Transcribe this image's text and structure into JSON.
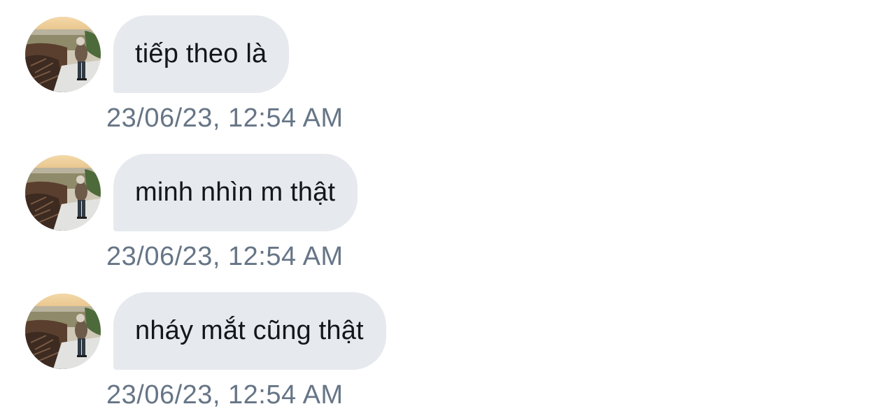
{
  "conversation": {
    "messages": [
      {
        "text": "tiếp theo là",
        "timestamp": "23/06/23, 12:54 AM",
        "avatar_icon": "user-avatar-photo"
      },
      {
        "text": "minh nhìn m thật",
        "timestamp": "23/06/23, 12:54 AM",
        "avatar_icon": "user-avatar-photo"
      },
      {
        "text": "nháy mắt cũng thật",
        "timestamp": "23/06/23, 12:54 AM",
        "avatar_icon": "user-avatar-photo"
      }
    ]
  },
  "colors": {
    "background": "#ffffff",
    "bubble": "#e6e9ee",
    "message_text": "#14171a",
    "timestamp_text": "#667586"
  }
}
